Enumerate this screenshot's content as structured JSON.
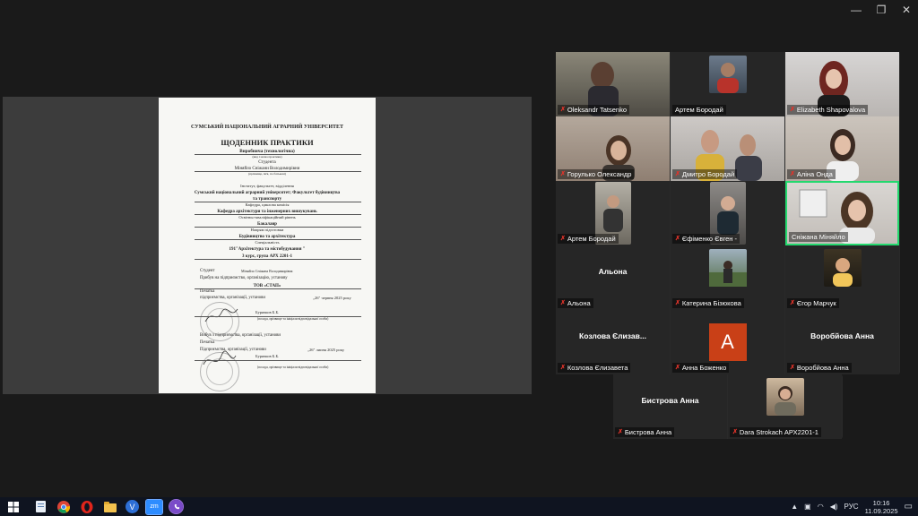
{
  "window": {
    "controls": [
      "—",
      "❐",
      "✕"
    ]
  },
  "document": {
    "university": "СУМСЬКИЙ НАЦІОНАЛЬНИЙ АГРАРНИЙ УНІВЕРСИТЕТ",
    "title": "ЩОДЕННИК ПРАКТИКИ",
    "practice_type": "Виробнича (технологічна)",
    "practice_type_hint": "(вид і назва практики)",
    "student_label": "Студента",
    "student_name": "Міняйло Сніжани Володимирівни",
    "student_name_hint": "(прізвище, ім'я, по батькові)",
    "institute_hint": "Інститут, факультет, відділення",
    "institute_line1": "Сумський національний аграрний університет; Факультет будівництва",
    "institute_line2": "та транспорту",
    "department_hint": "Кафедра, циклова комісія",
    "department": "Кафедра архітектури та інженерних вишукувань",
    "level_hint": "Освітньо-кваліфікаційний рівень",
    "level": "Бакалавр",
    "field_hint": "Напрям підготовки",
    "field": "Будівництво та архітектура",
    "specialty_hint": "Спеціальність",
    "specialty": "191\"Архітектура та містобудування \"",
    "course": "3 курс, група АРХ 2201-1",
    "student_row_label": "Студент",
    "student_row_value": "Міняйло Сніжана Володимирівна",
    "arrived_label": "Прибув на підприємство, організацію, установу",
    "company": "ТОВ «СТАП»",
    "stamp_label": "Печатка",
    "org_label": "підприємства, організації, установи",
    "arrival_date": "„26\" червня 2025 року",
    "signer": "Бурячков Б.Б.",
    "signer_hint": "(посада, прізвище та ініціали відповідальної особи)",
    "left_label": "Вибув з підприємства, організації, установи",
    "stamp_label2": "Печатка",
    "org_label2": "Підприємства, організації, установи",
    "leave_date": "„26\" липня 2025 року",
    "signer2": "Бурячков Б.Б.",
    "signer_hint2": "(посада, прізвище та ініціали відповідальної особи)"
  },
  "participants": [
    {
      "name": "Oleksandr Tatsenko",
      "type": "video",
      "muted": true
    },
    {
      "name": "Артем Бородай",
      "type": "small",
      "muted": false
    },
    {
      "name": "Elizabeth Shapovalova",
      "type": "video",
      "muted": true
    },
    {
      "name": "Горулько Олександр",
      "type": "video",
      "muted": true
    },
    {
      "name": "Дмитро Бородай",
      "type": "video",
      "muted": true
    },
    {
      "name": "Аліна Онда",
      "type": "video",
      "muted": true
    },
    {
      "name": "Артем Бородай",
      "type": "small",
      "muted": true
    },
    {
      "name": "Єфіменко Євген -",
      "type": "small",
      "muted": true
    },
    {
      "name": "Сніжана Міняйло",
      "type": "video",
      "muted": false,
      "active": true
    },
    {
      "name": "Альона",
      "type": "name",
      "display": "Альона",
      "muted": true
    },
    {
      "name": "Катерина Бізюкова",
      "type": "small",
      "muted": true
    },
    {
      "name": "Єгор Марчук",
      "type": "small",
      "muted": true
    },
    {
      "name": "Козлова Єлизавета",
      "type": "name",
      "display": "Козлова Єлизав...",
      "muted": true
    },
    {
      "name": "Анна Боженко",
      "type": "avatar",
      "initial": "A",
      "muted": true
    },
    {
      "name": "Воробйова Анна",
      "type": "name",
      "display": "Воробйова Анна",
      "muted": true
    },
    {
      "name": "Бистрова Анна",
      "type": "name",
      "display": "Бистрова Анна",
      "muted": true
    },
    {
      "name": "Dara Strokach АРХ2201-1",
      "type": "small",
      "muted": true
    }
  ],
  "taskbar": {
    "apps": [
      "windows-start",
      "file-app",
      "chrome",
      "opera",
      "explorer",
      "viber",
      "zoom",
      "viber-2"
    ],
    "zoom_label": "zm",
    "viber_label": "V",
    "language": "РУС",
    "time": "10:16",
    "date": "11.09.2025"
  }
}
